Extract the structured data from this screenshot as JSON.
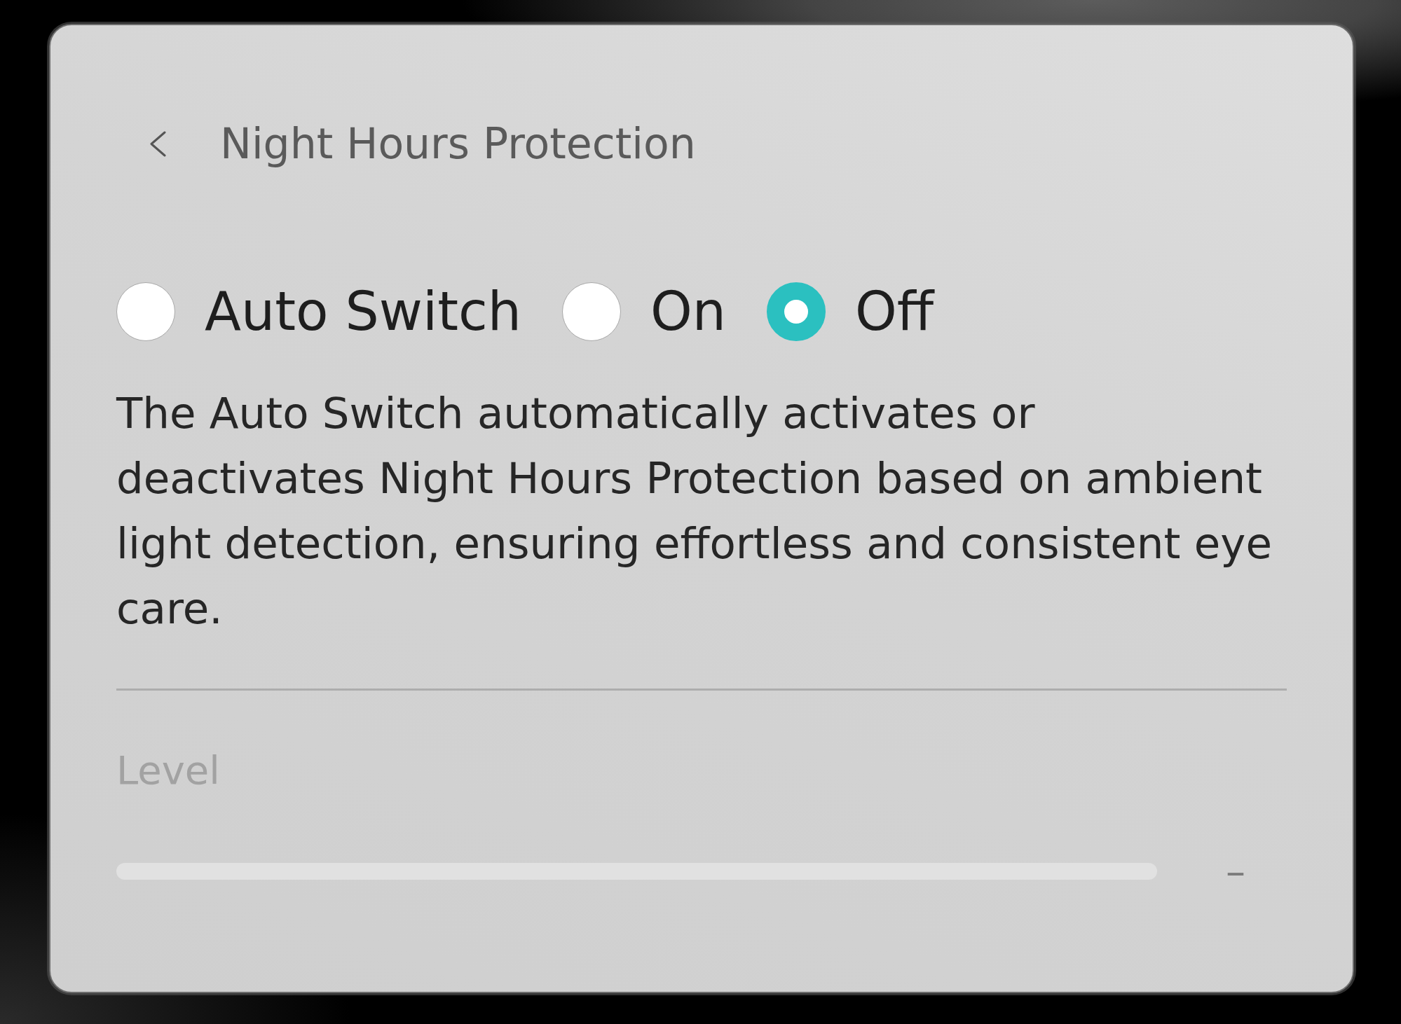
{
  "header": {
    "title": "Night Hours Protection"
  },
  "mode": {
    "options": [
      {
        "label": "Auto Switch",
        "selected": false
      },
      {
        "label": "On",
        "selected": false
      },
      {
        "label": "Off",
        "selected": true
      }
    ]
  },
  "description": "The Auto Switch automatically activates or deactivates Night Hours Protection based on ambient light detection, ensuring effortless and consistent eye care.",
  "level_setting": {
    "label": "Level",
    "disabled": true,
    "reading": "–"
  }
}
